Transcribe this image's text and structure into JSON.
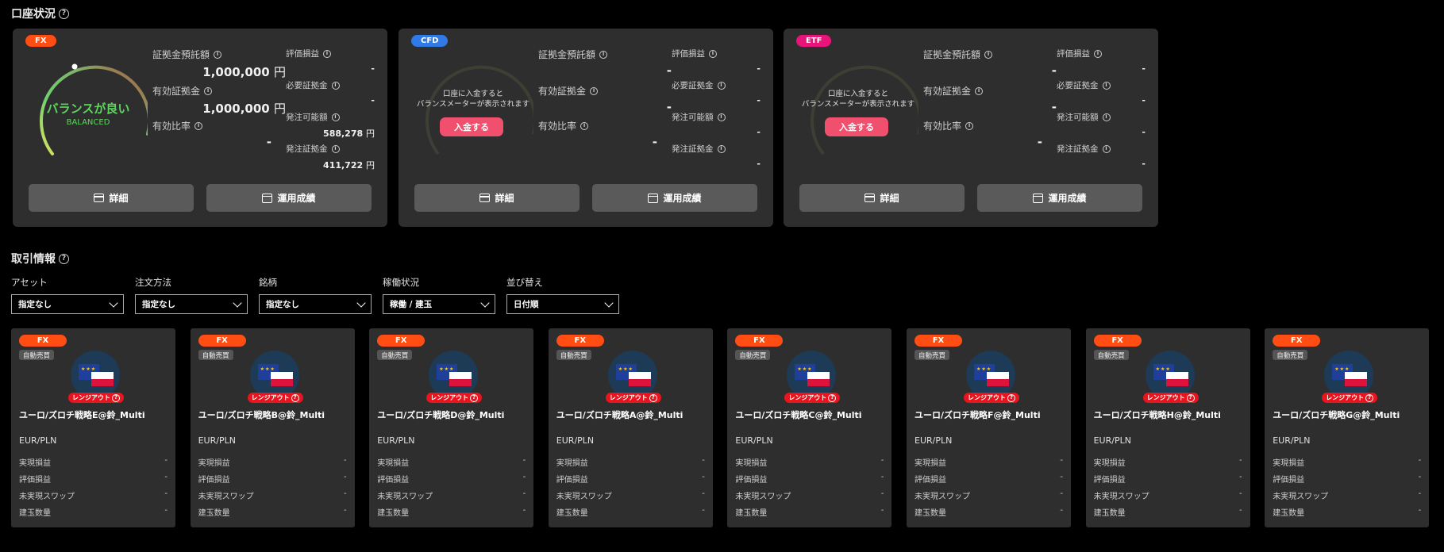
{
  "account_section": {
    "title": "口座状況"
  },
  "trade_section": {
    "title": "取引情報"
  },
  "accounts": [
    {
      "badge": "FX",
      "badge_color": "#ff4d14",
      "gauge_title": "バランスが良い",
      "gauge_sub": "BALANCED",
      "margin_deposit_label": "証拠金預託額",
      "margin_deposit_value": "1,000,000",
      "margin_deposit_unit": "円",
      "effective_margin_label": "有効証拠金",
      "effective_margin_value": "1,000,000",
      "effective_margin_unit": "円",
      "margin_ratio_label": "有効比率",
      "margin_ratio_value": "-",
      "unrealized_label": "評価損益",
      "unrealized_value": "-",
      "required_label": "必要証拠金",
      "required_value": "-",
      "orderable_label": "発注可能額",
      "orderable_value": "588,278",
      "orderable_unit": "円",
      "order_margin_label": "発注証拠金",
      "order_margin_value": "411,722",
      "order_margin_unit": "円",
      "detail_btn": "詳細",
      "perf_btn": "運用成績"
    },
    {
      "badge": "CFD",
      "badge_color": "#2f7ae5",
      "gauge_message": "口座に入金すると\nバランスメーターが表示されます",
      "deposit_btn": "入金する",
      "margin_deposit_label": "証拠金預託額",
      "margin_deposit_value": "-",
      "effective_margin_label": "有効証拠金",
      "effective_margin_value": "-",
      "margin_ratio_label": "有効比率",
      "margin_ratio_value": "-",
      "unrealized_label": "評価損益",
      "unrealized_value": "-",
      "required_label": "必要証拠金",
      "required_value": "-",
      "orderable_label": "発注可能額",
      "orderable_value": "-",
      "order_margin_label": "発注証拠金",
      "order_margin_value": "-",
      "detail_btn": "詳細",
      "perf_btn": "運用成績"
    },
    {
      "badge": "ETF",
      "badge_color": "#e8147a",
      "gauge_message": "口座に入金すると\nバランスメーターが表示されます",
      "deposit_btn": "入金する",
      "margin_deposit_label": "証拠金預託額",
      "margin_deposit_value": "-",
      "effective_margin_label": "有効証拠金",
      "effective_margin_value": "-",
      "margin_ratio_label": "有効比率",
      "margin_ratio_value": "-",
      "unrealized_label": "評価損益",
      "unrealized_value": "-",
      "required_label": "必要証拠金",
      "required_value": "-",
      "orderable_label": "発注可能額",
      "orderable_value": "-",
      "order_margin_label": "発注証拠金",
      "order_margin_value": "-",
      "detail_btn": "詳細",
      "perf_btn": "運用成績"
    }
  ],
  "filters": [
    {
      "label": "アセット",
      "value": "指定なし"
    },
    {
      "label": "注文方法",
      "value": "指定なし"
    },
    {
      "label": "銘柄",
      "value": "指定なし"
    },
    {
      "label": "稼働状況",
      "value": "稼働 / 建玉"
    },
    {
      "label": "並び替え",
      "value": "日付順"
    }
  ],
  "strategies": [
    {
      "badge": "FX",
      "type": "自動売買",
      "range": "レンジアウト",
      "name": "ユーロ/ズロチ戦略E@鈴_Multi",
      "pair": "EUR/PLN"
    },
    {
      "badge": "FX",
      "type": "自動売買",
      "range": "レンジアウト",
      "name": "ユーロ/ズロチ戦略B@鈴_Multi",
      "pair": "EUR/PLN"
    },
    {
      "badge": "FX",
      "type": "自動売買",
      "range": "レンジアウト",
      "name": "ユーロ/ズロチ戦略D@鈴_Multi",
      "pair": "EUR/PLN"
    },
    {
      "badge": "FX",
      "type": "自動売買",
      "range": "レンジアウト",
      "name": "ユーロ/ズロチ戦略A@鈴_Multi",
      "pair": "EUR/PLN"
    },
    {
      "badge": "FX",
      "type": "自動売買",
      "range": "レンジアウト",
      "name": "ユーロ/ズロチ戦略C@鈴_Multi",
      "pair": "EUR/PLN"
    },
    {
      "badge": "FX",
      "type": "自動売買",
      "range": "レンジアウト",
      "name": "ユーロ/ズロチ戦略F@鈴_Multi",
      "pair": "EUR/PLN"
    },
    {
      "badge": "FX",
      "type": "自動売買",
      "range": "レンジアウト",
      "name": "ユーロ/ズロチ戦略H@鈴_Multi",
      "pair": "EUR/PLN"
    },
    {
      "badge": "FX",
      "type": "自動売買",
      "range": "レンジアウト",
      "name": "ユーロ/ズロチ戦略G@鈴_Multi",
      "pair": "EUR/PLN"
    }
  ],
  "strategy_rows": {
    "realized": "実現損益",
    "unrealized": "評価損益",
    "swap": "未実現スワップ",
    "quantity": "建玉数量",
    "empty": "-"
  },
  "colors": {
    "accent_green": "#5cd65c",
    "deposit_pink": "#f0506e",
    "range_red": "#e8141e"
  }
}
